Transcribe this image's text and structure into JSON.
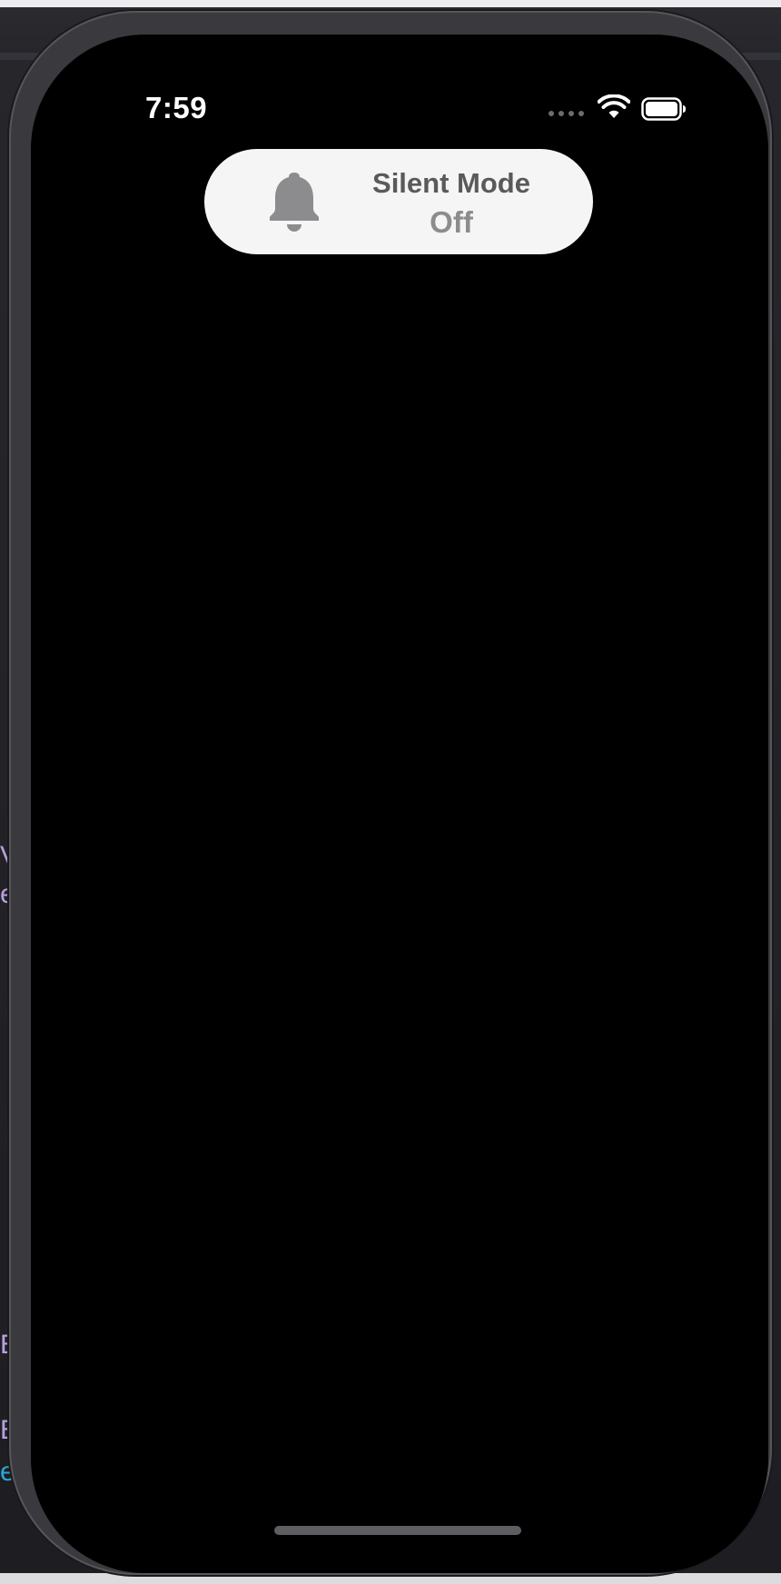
{
  "status_bar": {
    "time": "7:59",
    "icons": [
      "cellular-dots-icon",
      "wifi-icon",
      "battery-icon"
    ]
  },
  "silent_mode_banner": {
    "title": "Silent Mode",
    "status": "Off",
    "icon": "bell-icon"
  },
  "background_edge_text": [
    "V",
    "e",
    "E",
    "E",
    "e"
  ],
  "colors": {
    "screen": "#000000",
    "banner": "#f5f5f5",
    "banner_title": "#5a5a5c",
    "banner_status": "#8c8c8f",
    "bell": "#8c8c8f",
    "edge_text_purple": "#b89fe0",
    "edge_text_cyan": "#2aa7d8"
  }
}
